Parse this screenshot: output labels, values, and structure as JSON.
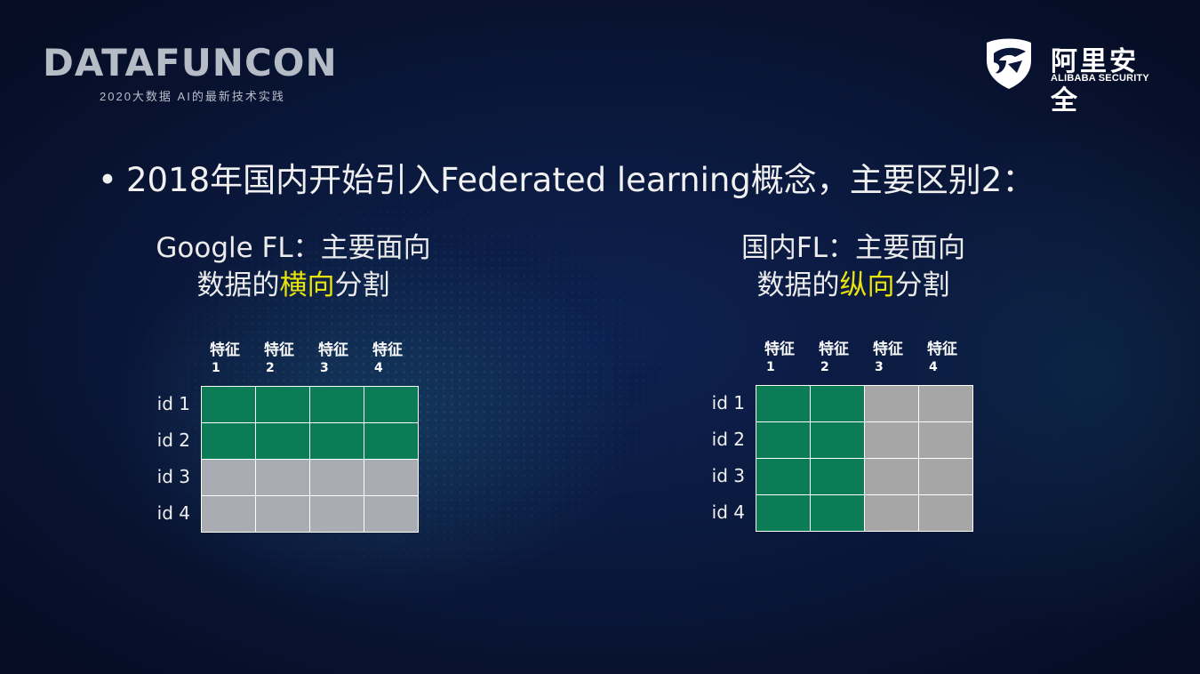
{
  "header": {
    "brand_title": "DATAFUNCON",
    "brand_subtitle": "2020大数据 AI的最新技术实践",
    "logo_cn": "阿里安全",
    "logo_en": "ALIBABA SECURITY"
  },
  "bullet": {
    "text": "2018年国内开始引入Federated learning概念，主要区别2："
  },
  "left": {
    "heading_line1": "Google FL：主要面向",
    "heading_line2_pre": "数据的",
    "heading_line2_hl": "横向",
    "heading_line2_post": "分割",
    "col_label": "特征",
    "col_numbers": [
      "1",
      "2",
      "3",
      "4"
    ],
    "rows": [
      "id 1",
      "id 2",
      "id 3",
      "id 4"
    ],
    "highlight_color": "#0b7c55",
    "rest_color": "#a9adb3"
  },
  "right": {
    "heading_line1": "国内FL：主要面向",
    "heading_line2_pre": "数据的",
    "heading_line2_hl": "纵向",
    "heading_line2_post": "分割",
    "col_label": "特征",
    "col_numbers": [
      "1",
      "2",
      "3",
      "4"
    ],
    "rows": [
      "id 1",
      "id 2",
      "id 3",
      "id 4"
    ],
    "highlight_color": "#0b7c55",
    "rest_color": "#a6a6a6"
  },
  "colors": {
    "accent_yellow": "#e8e30c",
    "background": "#0a173a"
  }
}
